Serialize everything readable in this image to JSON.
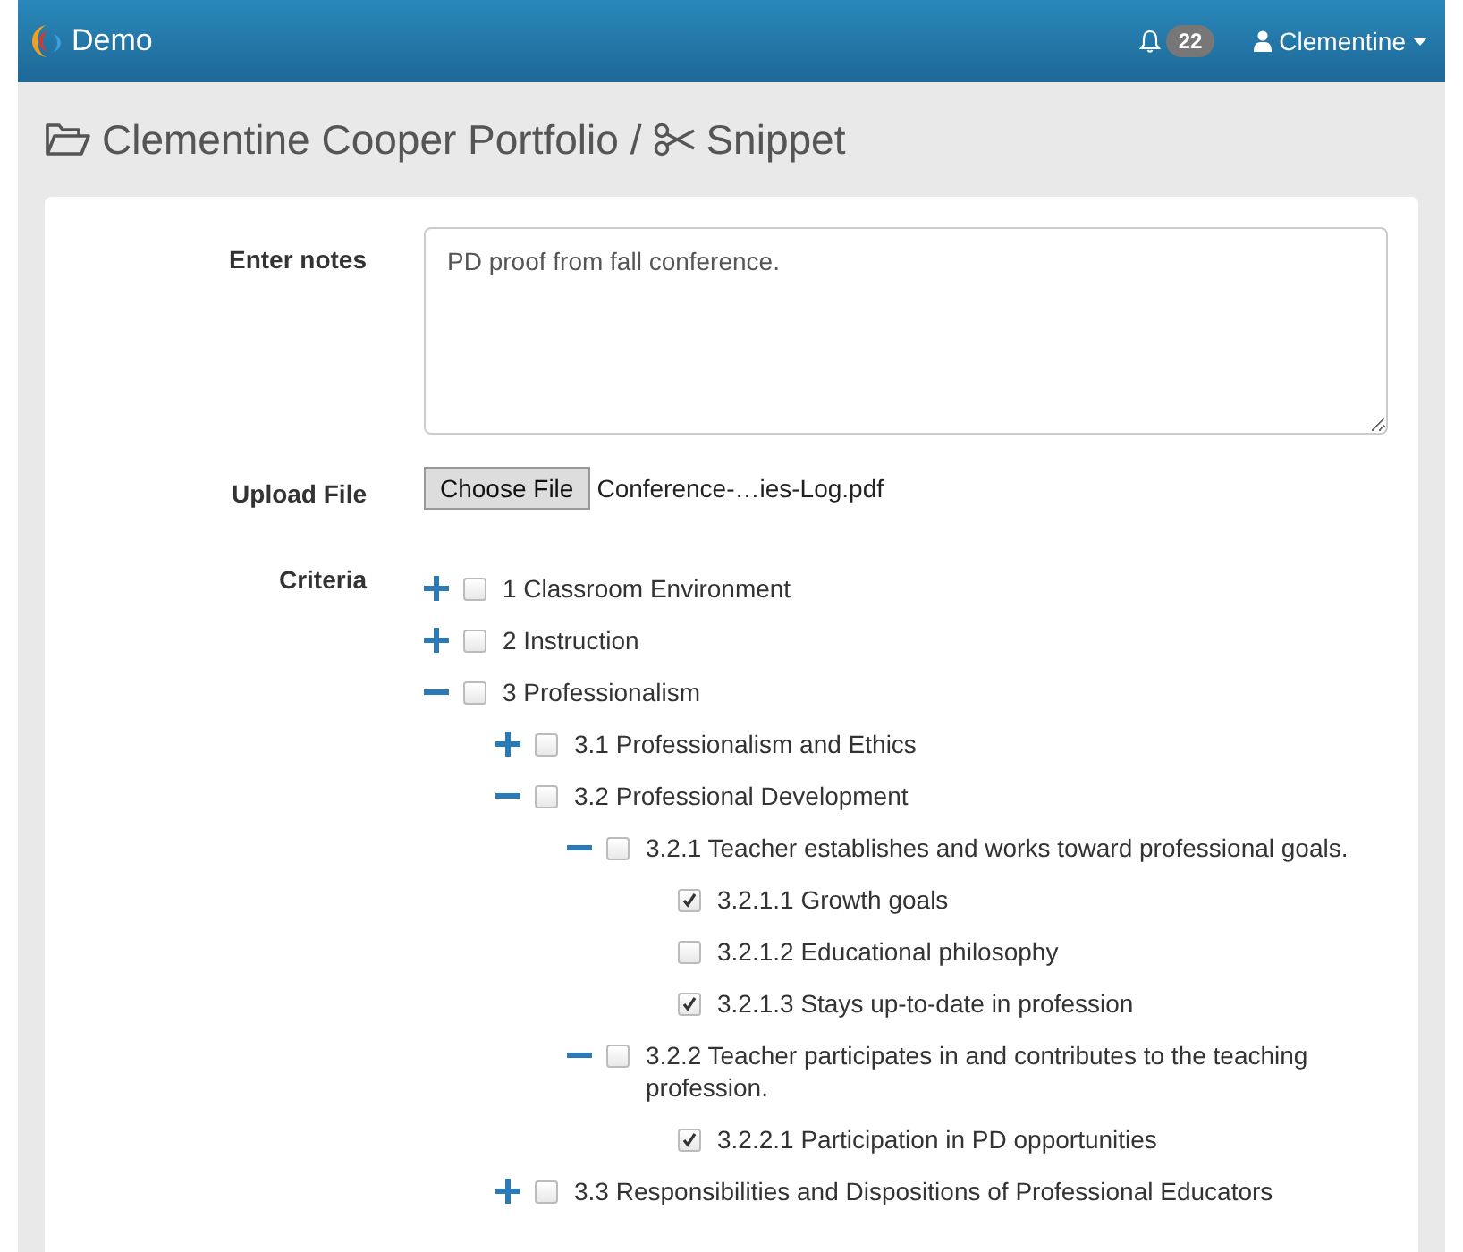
{
  "navbar": {
    "brand": "Demo",
    "notifications": "22",
    "user": "Clementine"
  },
  "page_title": {
    "portfolio": "Clementine Cooper Portfolio /",
    "section": "Snippet"
  },
  "form": {
    "notes_label": "Enter notes",
    "notes_value": "PD proof from fall conference.",
    "upload_label": "Upload File",
    "choose_button": "Choose File",
    "file_name": "Conference-…ies-Log.pdf",
    "criteria_label": "Criteria"
  },
  "criteria": [
    {
      "label": "1 Classroom Environment",
      "checked": false,
      "expanded": false
    },
    {
      "label": "2 Instruction",
      "checked": false,
      "expanded": false
    },
    {
      "label": "3 Professionalism",
      "checked": false,
      "expanded": true,
      "children": [
        {
          "label": "3.1 Professionalism and Ethics",
          "checked": false,
          "expanded": false
        },
        {
          "label": "3.2 Professional Development",
          "checked": false,
          "expanded": true,
          "children": [
            {
              "label": "3.2.1 Teacher establishes and works toward professional goals.",
              "checked": false,
              "expanded": true,
              "children": [
                {
                  "label": "3.2.1.1 Growth goals",
                  "checked": true
                },
                {
                  "label": "3.2.1.2 Educational philosophy",
                  "checked": false
                },
                {
                  "label": "3.2.1.3 Stays up-to-date in profession",
                  "checked": true
                }
              ]
            },
            {
              "label": "3.2.2 Teacher participates in and contributes to the teaching profession.",
              "checked": false,
              "expanded": true,
              "children": [
                {
                  "label": "3.2.2.1 Participation in PD opportunities",
                  "checked": true
                }
              ]
            }
          ]
        },
        {
          "label": "3.3 Responsibilities and Dispositions of Professional Educators",
          "checked": false,
          "expanded": false
        }
      ]
    }
  ]
}
